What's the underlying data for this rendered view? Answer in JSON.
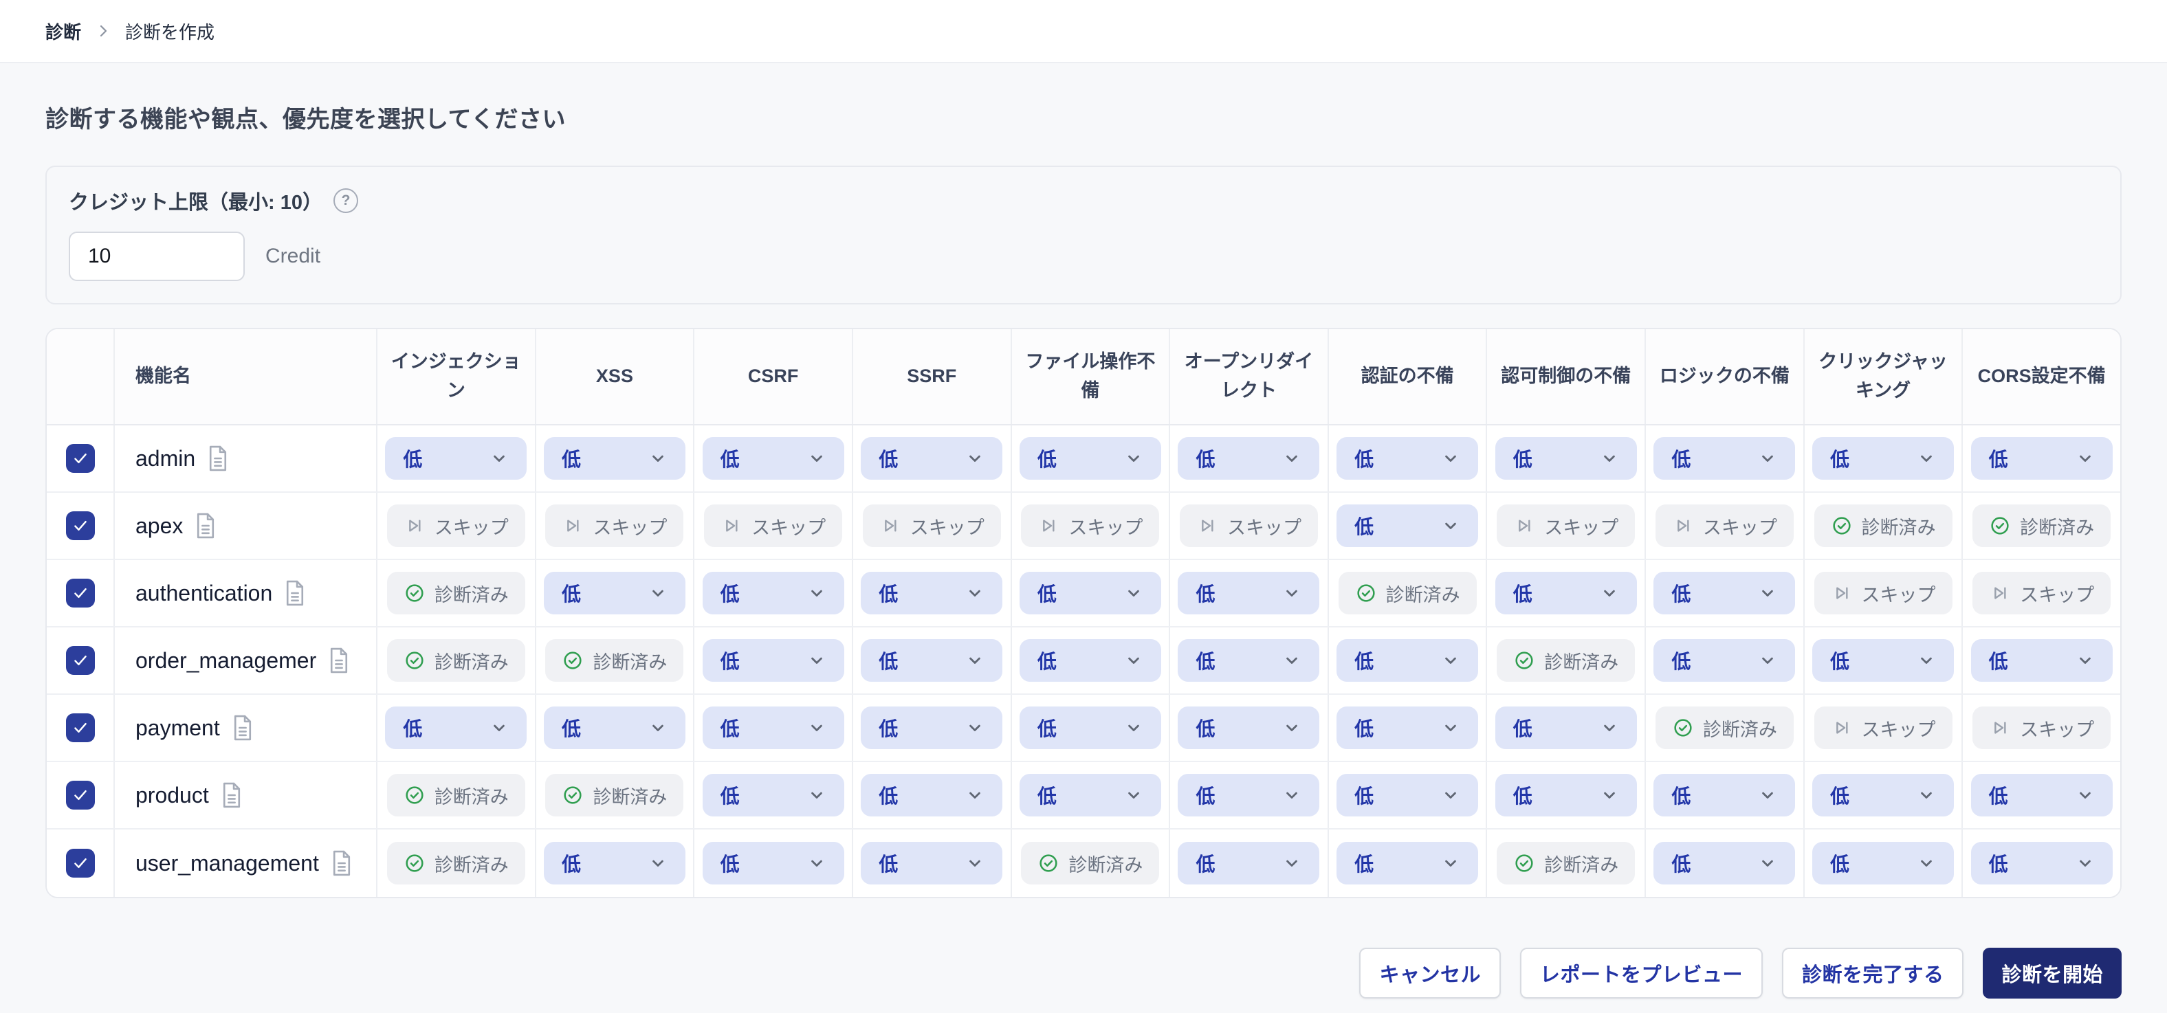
{
  "breadcrumb": {
    "items": [
      "診断",
      "診断を作成"
    ]
  },
  "page": {
    "title": "診断する機能や観点、優先度を選択してください"
  },
  "icons": {
    "help": "?"
  },
  "credit": {
    "label": "クレジット上限（最小: 10）",
    "value": "10",
    "unit": "Credit"
  },
  "table": {
    "columns": [
      "機能名",
      "インジェクション",
      "XSS",
      "CSRF",
      "SSRF",
      "ファイル操作不備",
      "オープンリダイレクト",
      "認証の不備",
      "認可制御の不備",
      "ロジックの不備",
      "クリックジャッキング",
      "CORS設定不備"
    ],
    "cell_labels": {
      "low": "低",
      "skip": "スキップ",
      "done": "診断済み"
    },
    "rows": [
      {
        "name": "admin",
        "checked": true,
        "cells": [
          "low",
          "low",
          "low",
          "low",
          "low",
          "low",
          "low",
          "low",
          "low",
          "low",
          "low"
        ]
      },
      {
        "name": "apex",
        "checked": true,
        "cells": [
          "skip",
          "skip",
          "skip",
          "skip",
          "skip",
          "skip",
          "low",
          "skip",
          "skip",
          "done",
          "done"
        ]
      },
      {
        "name": "authentication",
        "checked": true,
        "cells": [
          "done",
          "low",
          "low",
          "low",
          "low",
          "low",
          "done",
          "low",
          "low",
          "skip",
          "skip"
        ]
      },
      {
        "name": "order_managemer",
        "checked": true,
        "cells": [
          "done",
          "done",
          "low",
          "low",
          "low",
          "low",
          "low",
          "done",
          "low",
          "low",
          "low"
        ]
      },
      {
        "name": "payment",
        "checked": true,
        "cells": [
          "low",
          "low",
          "low",
          "low",
          "low",
          "low",
          "low",
          "low",
          "done",
          "skip",
          "skip"
        ]
      },
      {
        "name": "product",
        "checked": true,
        "cells": [
          "done",
          "done",
          "low",
          "low",
          "low",
          "low",
          "low",
          "low",
          "low",
          "low",
          "low"
        ]
      },
      {
        "name": "user_management",
        "checked": true,
        "cells": [
          "done",
          "low",
          "low",
          "low",
          "done",
          "low",
          "low",
          "done",
          "low",
          "low",
          "low"
        ]
      }
    ]
  },
  "actions": [
    {
      "label": "キャンセル",
      "variant": "outline"
    },
    {
      "label": "レポートをプレビュー",
      "variant": "outline"
    },
    {
      "label": "診断を完了する",
      "variant": "outline"
    },
    {
      "label": "診断を開始",
      "variant": "primary"
    }
  ],
  "colors": {
    "accent": "#2334a4",
    "primary": "#1f2a72",
    "checkbox-bg": "#2c3e9c",
    "chip-select-bg": "#dfe5f8",
    "chip-select-text": "#2236a8",
    "chip-status-bg": "#f0f1f4",
    "chip-status-text": "#6a7280",
    "done-green": "#2f9e4f",
    "page-bg": "#f7f8fa"
  }
}
